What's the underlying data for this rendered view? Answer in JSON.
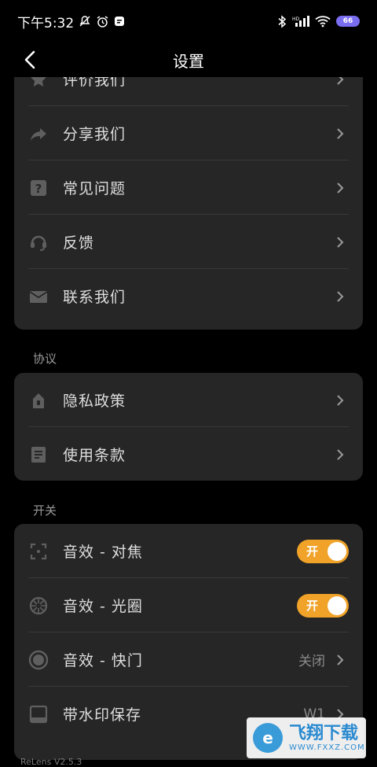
{
  "status_bar": {
    "time": "下午5:32",
    "battery": "66"
  },
  "header": {
    "title": "设置"
  },
  "group1": {
    "items": [
      {
        "label": "评价我们",
        "icon": "star-icon"
      },
      {
        "label": "分享我们",
        "icon": "share-icon"
      },
      {
        "label": "常见问题",
        "icon": "question-icon"
      },
      {
        "label": "反馈",
        "icon": "headset-icon"
      },
      {
        "label": "联系我们",
        "icon": "mail-icon"
      }
    ]
  },
  "group2": {
    "title": "协议",
    "items": [
      {
        "label": "隐私政策",
        "icon": "lock-icon"
      },
      {
        "label": "使用条款",
        "icon": "document-icon"
      }
    ]
  },
  "group3": {
    "title": "开关",
    "items": [
      {
        "label": "音效 - 对焦",
        "icon": "focus-icon",
        "toggle": "开",
        "on": true
      },
      {
        "label": "音效 - 光圈",
        "icon": "aperture-icon",
        "toggle": "开",
        "on": true
      },
      {
        "label": "音效 - 快门",
        "icon": "shutter-icon",
        "value": "关闭"
      },
      {
        "label": "带水印保存",
        "icon": "watermark-icon",
        "value": "W1"
      }
    ]
  },
  "footer": {
    "version": "ReLens V2.5.3"
  },
  "watermark": {
    "logo": "e",
    "title": "飞翔下载",
    "url": "WWW.FXXZ.COM"
  },
  "colors": {
    "accent": "#f0a328",
    "card": "#262626",
    "background": "#000000"
  }
}
